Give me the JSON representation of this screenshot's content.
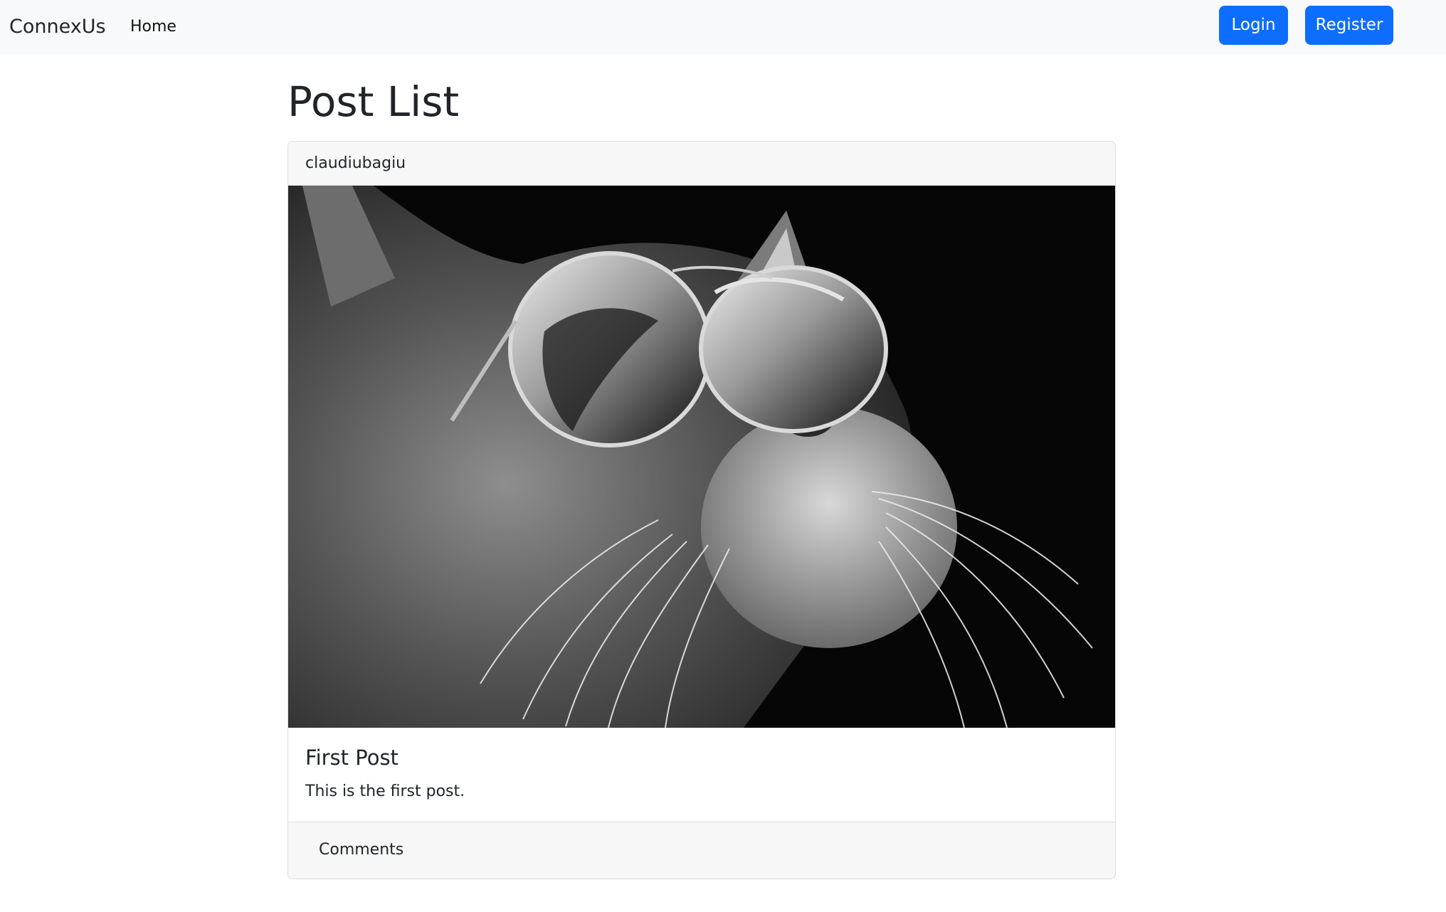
{
  "navbar": {
    "brand": "ConnexUs",
    "home_label": "Home",
    "login_label": "Login",
    "register_label": "Register"
  },
  "main": {
    "title": "Post List",
    "posts": [
      {
        "username": "claudiubagiu",
        "image_alt": "cat wearing sunglasses photo",
        "title": "First Post",
        "text": "This is the first post.",
        "comments_label": "Comments"
      }
    ]
  },
  "colors": {
    "navbar_bg": "#f8f9fa",
    "primary": "#0d6efd",
    "text": "#212529",
    "card_border": "#dcdde0",
    "card_cap_bg": "#f7f7f7"
  }
}
